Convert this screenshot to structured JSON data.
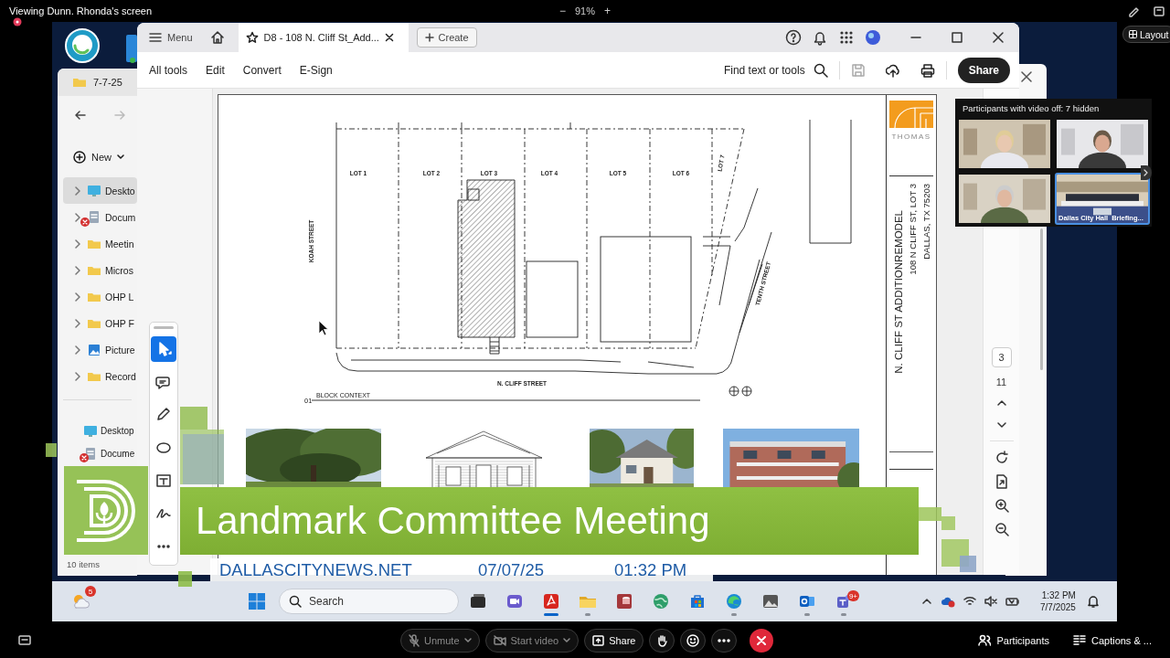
{
  "viewer": {
    "banner": "Viewing Dunn. Rhonda's screen",
    "zoom_out": "−",
    "zoom_level": "91%",
    "zoom_in": "+",
    "layout_button": "Layout"
  },
  "explorer": {
    "folder_tab": "7-7-25",
    "new_button": "New",
    "nav_items": [
      {
        "label": "Deskto",
        "kind": "desktop",
        "selected": true,
        "sync_error": false
      },
      {
        "label": "Docum",
        "kind": "documents",
        "selected": false,
        "sync_error": true
      },
      {
        "label": "Meetin",
        "kind": "folder",
        "selected": false,
        "sync_error": false
      },
      {
        "label": "Micros",
        "kind": "folder",
        "selected": false,
        "sync_error": false
      },
      {
        "label": "OHP L",
        "kind": "folder",
        "selected": false,
        "sync_error": false
      },
      {
        "label": "OHP F",
        "kind": "folder",
        "selected": false,
        "sync_error": false
      },
      {
        "label": "Picture",
        "kind": "pictures",
        "selected": false,
        "sync_error": false
      },
      {
        "label": "Record",
        "kind": "folder",
        "selected": false,
        "sync_error": false
      }
    ],
    "quick_items": [
      {
        "label": "Desktop",
        "kind": "desktop",
        "sync_error": false
      },
      {
        "label": "Docume",
        "kind": "documents",
        "sync_error": true
      }
    ],
    "status": "10 items"
  },
  "acrobat": {
    "menu": "Menu",
    "tab_title": "D8 - 108 N. Cliff St_Add...",
    "create_button": "Create",
    "menu_bar": [
      "All tools",
      "Edit",
      "Convert",
      "E-Sign"
    ],
    "find": "Find text or tools",
    "share_button": "Share",
    "tools": [
      {
        "kind": "select",
        "selected": true
      },
      {
        "kind": "comment",
        "selected": false
      },
      {
        "kind": "draw",
        "selected": false
      },
      {
        "kind": "shape",
        "selected": false
      },
      {
        "kind": "text",
        "selected": false
      },
      {
        "kind": "sign",
        "selected": false
      },
      {
        "kind": "more",
        "selected": false
      }
    ],
    "page_number": "3",
    "page_count": "11"
  },
  "document": {
    "lots": [
      "LOT 1",
      "LOT 2",
      "LOT 3",
      "LOT 4",
      "LOT 5",
      "LOT 6",
      "LOT 7"
    ],
    "streets": {
      "west": "KOAH STREET",
      "south": "N. CLIFF STREET",
      "east": "TENTH STREET"
    },
    "detail_number": "01",
    "detail_title": "BLOCK CONTEXT",
    "title_block": {
      "firm": "THOMAS",
      "project": "N. CLIFF ST ADDITIONREMODEL",
      "address": "108 N CLIFF ST, LOT 3",
      "city": "DALLAS, TX 75203"
    },
    "photos": [
      {
        "kind": "picture"
      },
      {
        "kind": "elevation"
      },
      {
        "kind": "picture"
      },
      {
        "kind": "picture"
      }
    ]
  },
  "lower_third": {
    "title": "Landmark Committee Meeting",
    "website": "DALLASCITYNEWS.NET",
    "date": "07/07/25",
    "time": "01:32 PM"
  },
  "gallery": {
    "header": "Participants with video off: 7 hidden",
    "tiles": [
      {
        "kind": "person",
        "selected": false
      },
      {
        "kind": "person",
        "selected": false
      },
      {
        "kind": "person",
        "selected": false
      },
      {
        "kind": "room",
        "selected": true,
        "labels": [
          "Dallas City Hall",
          "Briefing..."
        ]
      }
    ]
  },
  "taskbar": {
    "weather_badge": "5",
    "search": {
      "placeholder": "Search"
    },
    "apps": [
      {
        "kind": "taskview",
        "active": false,
        "running": false
      },
      {
        "kind": "meet",
        "active": false,
        "running": false
      },
      {
        "kind": "acrobat",
        "active": true,
        "running": true
      },
      {
        "kind": "folder",
        "active": false,
        "running": true
      },
      {
        "kind": "database",
        "active": false,
        "running": false
      },
      {
        "kind": "globe",
        "active": false,
        "running": false
      },
      {
        "kind": "store",
        "active": false,
        "running": false
      },
      {
        "kind": "browser",
        "active": false,
        "running": true
      },
      {
        "kind": "photos",
        "active": false,
        "running": false
      },
      {
        "kind": "mail",
        "active": false,
        "running": true
      },
      {
        "kind": "chat",
        "active": false,
        "running": true,
        "badge": "9+"
      }
    ],
    "time": "1:32 PM",
    "date": "7/7/2025"
  },
  "controls": {
    "unmute": "Unmute",
    "start_video": "Start video",
    "share": "Share",
    "participants": "Participants",
    "captions": "Captions & ..."
  }
}
